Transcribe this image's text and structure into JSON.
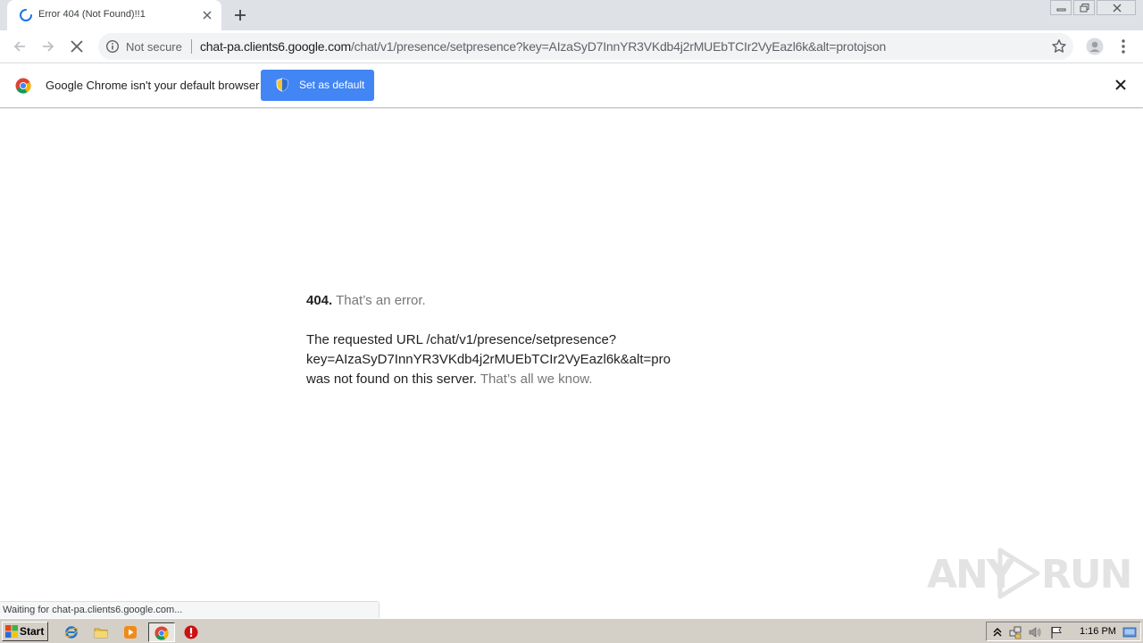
{
  "tab": {
    "title": "Error 404 (Not Found)!!1"
  },
  "toolbar": {
    "security_label": "Not secure",
    "url_host": "chat-pa.clients6.google.com",
    "url_path": "/chat/v1/presence/setpresence?key=AIzaSyD7InnYR3VKdb4j2rMUEbTCIr2VyEazl6k&alt=protojson"
  },
  "infobar": {
    "message": "Google Chrome isn't your default browser",
    "button_label": "Set as default"
  },
  "page": {
    "code": "404.",
    "tagline": "That’s an error.",
    "line1": "The requested URL /chat/v1/presence/setpresence?",
    "line2": "key=AIzaSyD7InnYR3VKdb4j2rMUEbTCIr2VyEazl6k&alt=pro",
    "line3": "was not found on this server.",
    "tail": "That’s all we know."
  },
  "watermark": {
    "left": "ANY",
    "right": "RUN"
  },
  "status": {
    "text": "Waiting for chat-pa.clients6.google.com..."
  },
  "taskbar": {
    "start_label": "Start",
    "clock": "1:16 PM"
  },
  "colors": {
    "accent": "#4285f4",
    "tabstrip": "#dee1e6",
    "omnibox": "#f1f3f4",
    "taskbar": "#d4d0c8"
  }
}
